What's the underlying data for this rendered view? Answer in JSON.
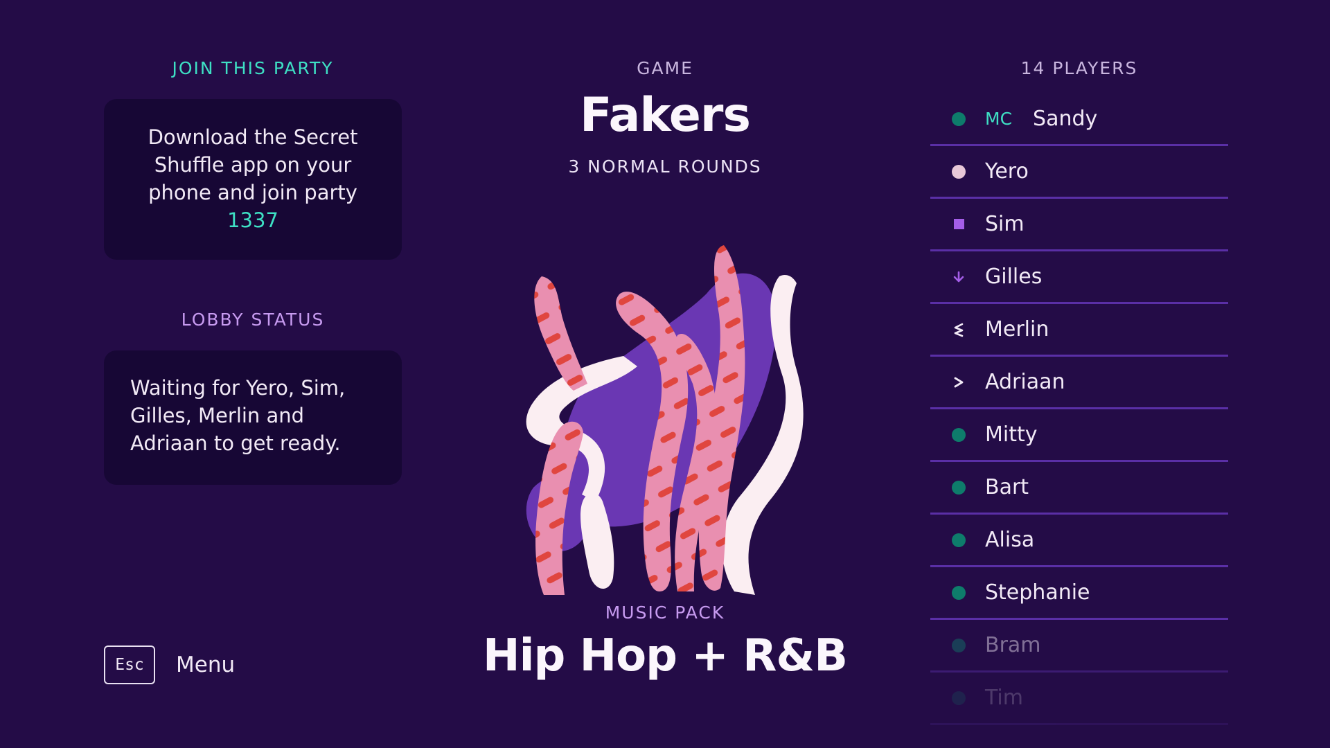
{
  "join": {
    "heading": "JOIN THIS PARTY",
    "text_before": "Download the Secret Shuffle app on your phone and join party ",
    "party_code": "1337"
  },
  "lobby": {
    "heading": "LOBBY STATUS",
    "status": "Waiting for Yero, Sim, Gilles, Merlin and Adriaan to get ready."
  },
  "menu": {
    "key": "Esc",
    "label": "Menu"
  },
  "game": {
    "heading": "GAME",
    "title": "Fakers",
    "rounds": "3 NORMAL ROUNDS"
  },
  "music_pack": {
    "heading": "MUSIC PACK",
    "title": "Hip Hop + R&B"
  },
  "players": {
    "heading": "14 PLAYERS",
    "mc_label": "MC",
    "list": [
      {
        "name": "Sandy",
        "icon": "ready-dot-icon",
        "color": "#0e7c6b"
      },
      {
        "name": "Yero",
        "icon": "not-ready-dot-icon",
        "color": "#e8c8d8"
      },
      {
        "name": "Sim",
        "icon": "square-icon",
        "color": "#a45ee8"
      },
      {
        "name": "Gilles",
        "icon": "arrow-down-icon",
        "color": "#a45ee8"
      },
      {
        "name": "Merlin",
        "icon": "less-than-icon",
        "color": "#f2eaf6"
      },
      {
        "name": "Adriaan",
        "icon": "greater-than-icon",
        "color": "#f2eaf6"
      },
      {
        "name": "Mitty",
        "icon": "ready-dot-icon",
        "color": "#0e7c6b"
      },
      {
        "name": "Bart",
        "icon": "ready-dot-icon",
        "color": "#0e7c6b"
      },
      {
        "name": "Alisa",
        "icon": "ready-dot-icon",
        "color": "#0e7c6b"
      },
      {
        "name": "Stephanie",
        "icon": "ready-dot-icon",
        "color": "#0e7c6b"
      },
      {
        "name": "Bram",
        "icon": "ready-dot-icon",
        "color": "#0e7c6b"
      },
      {
        "name": "Tim",
        "icon": "ready-dot-icon",
        "color": "#0e7c6b"
      }
    ]
  },
  "colors": {
    "background": "#240c47",
    "accent_teal": "#3ee0c4",
    "accent_lilac": "#c79bf0",
    "card": "#170735",
    "divider": "#5a2fa6"
  }
}
